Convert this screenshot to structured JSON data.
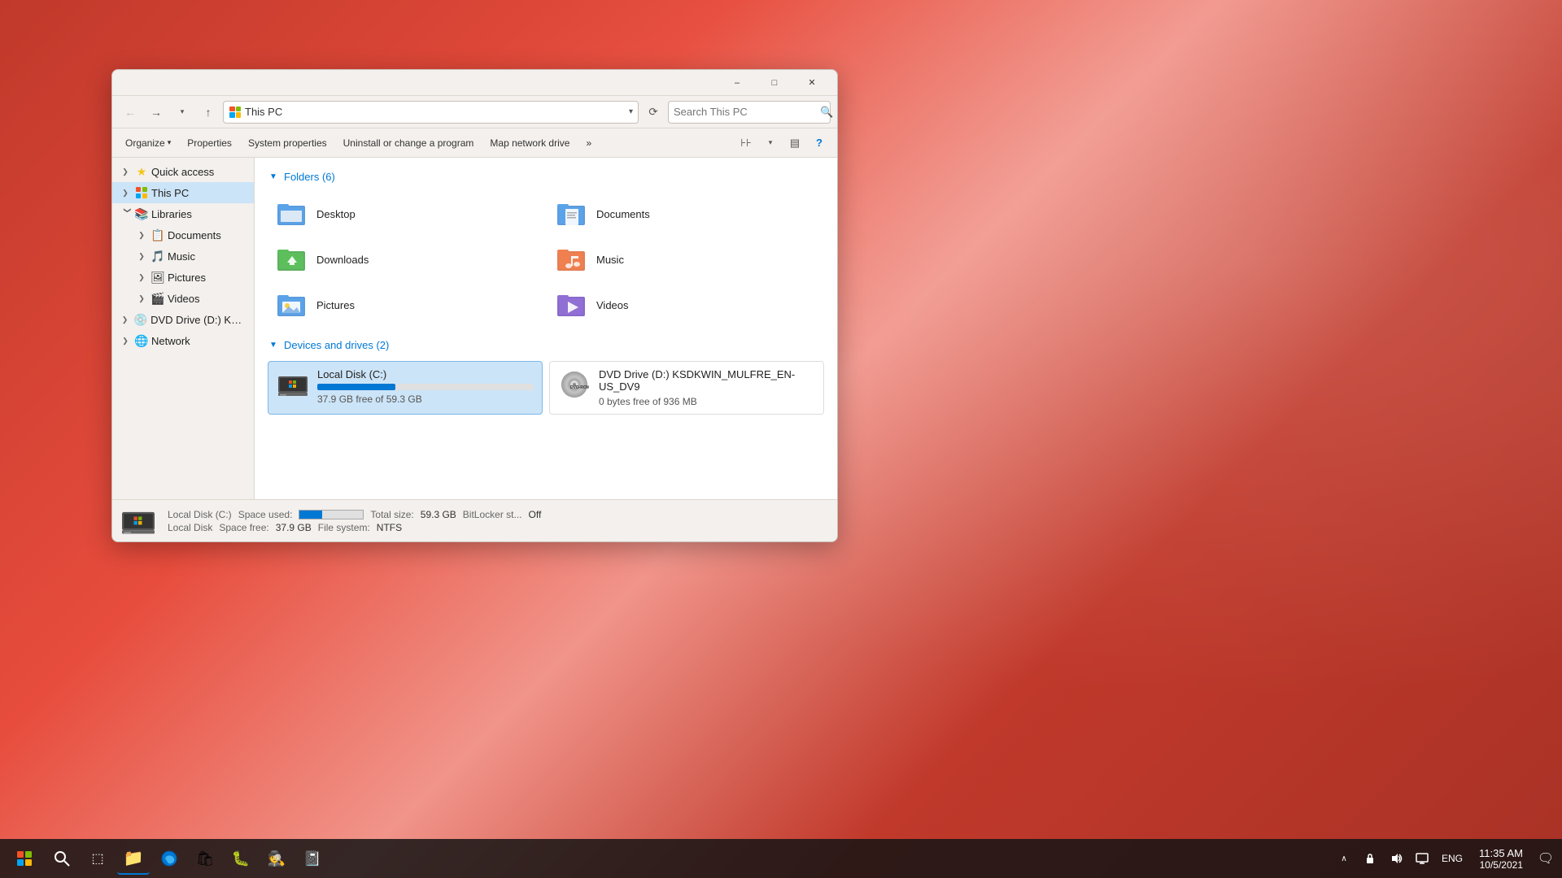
{
  "window": {
    "title": "This PC",
    "title_full": "This PC"
  },
  "toolbar": {
    "address": "This PC",
    "search_placeholder": "Search This PC",
    "back_label": "←",
    "forward_label": "→",
    "recent_label": "▾",
    "up_label": "↑",
    "refresh_label": "↻"
  },
  "commands": {
    "organize": "Organize",
    "properties": "Properties",
    "system_properties": "System properties",
    "uninstall": "Uninstall or change a program",
    "map_drive": "Map network drive",
    "more": "»"
  },
  "sections": {
    "folders": {
      "title": "Folders (6)",
      "items": [
        {
          "name": "Desktop",
          "color": "#3a86d4"
        },
        {
          "name": "Documents",
          "color": "#5a9fd4"
        },
        {
          "name": "Downloads",
          "color": "#4caf50"
        },
        {
          "name": "Music",
          "color": "#e07040"
        },
        {
          "name": "Pictures",
          "color": "#5a9fd4"
        },
        {
          "name": "Videos",
          "color": "#7c5ac4"
        }
      ]
    },
    "devices": {
      "title": "Devices and drives (2)",
      "items": [
        {
          "name": "Local Disk (C:)",
          "free": "37.9 GB free of 59.3 GB",
          "free_bytes": 37.9,
          "total_bytes": 59.3,
          "used_pct": 36,
          "type": "local"
        },
        {
          "name": "DVD Drive (D:) KSDKWIN_MULFRE_EN-US_DV9",
          "free": "0 bytes free of 936 MB",
          "free_bytes": 0,
          "total_bytes": 936,
          "used_pct": 0,
          "type": "dvd"
        }
      ]
    }
  },
  "sidebar": {
    "items": [
      {
        "label": "Quick access",
        "icon": "⭐",
        "expanded": false,
        "type": "quick-access"
      },
      {
        "label": "This PC",
        "icon": "💻",
        "expanded": true,
        "selected": true,
        "type": "thispc"
      },
      {
        "label": "Libraries",
        "icon": "📚",
        "expanded": true,
        "type": "libraries"
      },
      {
        "label": "Documents",
        "icon": "📋",
        "indent": 1,
        "type": "documents"
      },
      {
        "label": "Music",
        "icon": "🎵",
        "indent": 1,
        "type": "music"
      },
      {
        "label": "Pictures",
        "icon": "🖼",
        "indent": 1,
        "type": "pictures"
      },
      {
        "label": "Videos",
        "icon": "🎬",
        "indent": 1,
        "type": "videos"
      },
      {
        "label": "DVD Drive (D:) KSDK",
        "icon": "💿",
        "indent": 0,
        "type": "dvd"
      },
      {
        "label": "Network",
        "icon": "🌐",
        "indent": 0,
        "type": "network"
      }
    ]
  },
  "status_bar": {
    "drive_name": "Local Disk (C:)",
    "drive_label": "Local Disk",
    "space_used_label": "Space used:",
    "space_free_label": "Space free:",
    "space_free_value": "37.9 GB",
    "total_size_label": "Total size:",
    "total_size_value": "59.3 GB",
    "file_system_label": "File system:",
    "file_system_value": "NTFS",
    "bitlocker_label": "BitLocker st...",
    "bitlocker_value": "Off",
    "used_pct": 36
  },
  "taskbar": {
    "start_title": "Start",
    "search_title": "Search",
    "task_view_title": "Task View",
    "icons": [
      {
        "name": "start",
        "symbol": "⊞"
      },
      {
        "name": "search",
        "symbol": "🔍"
      },
      {
        "name": "task-view",
        "symbol": "⧉"
      },
      {
        "name": "file-explorer",
        "symbol": "📁"
      },
      {
        "name": "edge",
        "symbol": "🌊"
      },
      {
        "name": "store",
        "symbol": "🛍"
      },
      {
        "name": "bug",
        "symbol": "🐛"
      },
      {
        "name": "person",
        "symbol": "🕵"
      },
      {
        "name": "notepad",
        "symbol": "📓"
      }
    ],
    "systray": {
      "chevron": "^",
      "lock": "🔒",
      "volume": "🔊",
      "monitor": "🖥",
      "language": "ENG",
      "time": "11:35 AM",
      "date": "10/5/2021",
      "notification": "🗨"
    }
  }
}
